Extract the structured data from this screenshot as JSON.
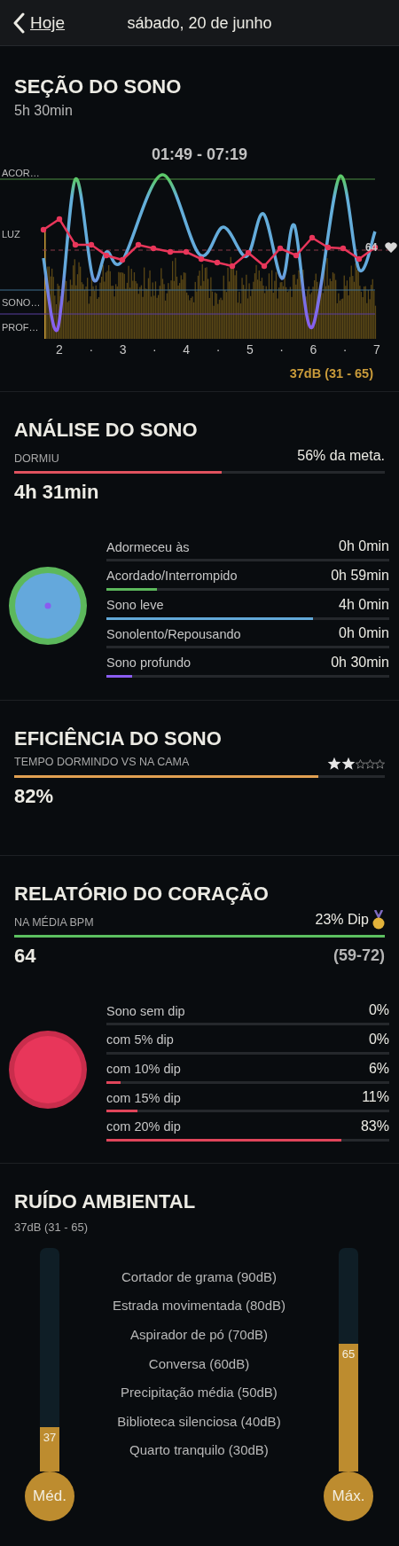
{
  "header": {
    "back_label": "Hoje",
    "title": "sábado, 20 de junho"
  },
  "sleep_session": {
    "title": "SEÇÃO DO SONO",
    "duration": "5h 30min",
    "time_range": "01:49 - 07:19",
    "stage_labels": [
      "ACOR…",
      "LUZ",
      "SONO…",
      "PROF…"
    ],
    "heart_rate_label": "64",
    "x_labels": [
      "2",
      "·",
      "3",
      "·",
      "4",
      "·",
      "5",
      "·",
      "6",
      "·",
      "7"
    ],
    "noise_summary": "37dB (31 - 65)"
  },
  "analysis": {
    "title": "ANÁLISE DO SONO",
    "label": "DORMIU",
    "goal_text": "56% da meta.",
    "level": 0.56,
    "value": "4h 31min",
    "stages": [
      {
        "name": "Adormeceu às",
        "value": "0h 0min",
        "level": 0
      },
      {
        "name": "Acordado/Interrompido",
        "value": "0h 59min",
        "level": 0.18,
        "color": "#5cb85c"
      },
      {
        "name": "Sono leve",
        "value": "4h 0min",
        "level": 0.73,
        "color": "#62a8d8"
      },
      {
        "name": "Sonolento/Repousando",
        "value": "0h 0min",
        "level": 0
      },
      {
        "name": "Sono profundo",
        "value": "0h 30min",
        "level": 0.09,
        "color": "#8a5cf0"
      }
    ]
  },
  "efficiency": {
    "title": "EFICIÊNCIA DO SONO",
    "label": "TEMPO DORMINDO VS NA CAMA",
    "stars": 2,
    "level": 0.82,
    "value": "82%"
  },
  "heart": {
    "title": "RELATÓRIO DO CORAÇÃO",
    "label": "NA MÉDIA BPM",
    "dip_text": "23% Dip",
    "level": 1,
    "value": "64",
    "range": "(59-72)",
    "dips": [
      {
        "name": "Sono sem dip",
        "value": "0%",
        "level": 0
      },
      {
        "name": "com 5% dip",
        "value": "0%",
        "level": 0
      },
      {
        "name": "com 10% dip",
        "value": "6%",
        "level": 0.05
      },
      {
        "name": "com 15% dip",
        "value": "11%",
        "level": 0.11
      },
      {
        "name": "com 20% dip",
        "value": "83%",
        "level": 0.83
      }
    ]
  },
  "noise": {
    "title": "RUÍDO AMBIENTAL",
    "summary": "37dB (31 - 65)",
    "references": [
      "Cortador de grama (90dB)",
      "Estrada movimentada (80dB)",
      "Aspirador de pó (70dB)",
      "Conversa (60dB)",
      "Precipitação média (50dB)",
      "Biblioteca silenciosa (40dB)",
      "Quarto tranquilo (30dB)"
    ],
    "meters": [
      {
        "label": "Méd.",
        "reading": "37",
        "level": 0.2
      },
      {
        "label": "Máx.",
        "reading": "65",
        "level": 0.57
      }
    ]
  }
}
